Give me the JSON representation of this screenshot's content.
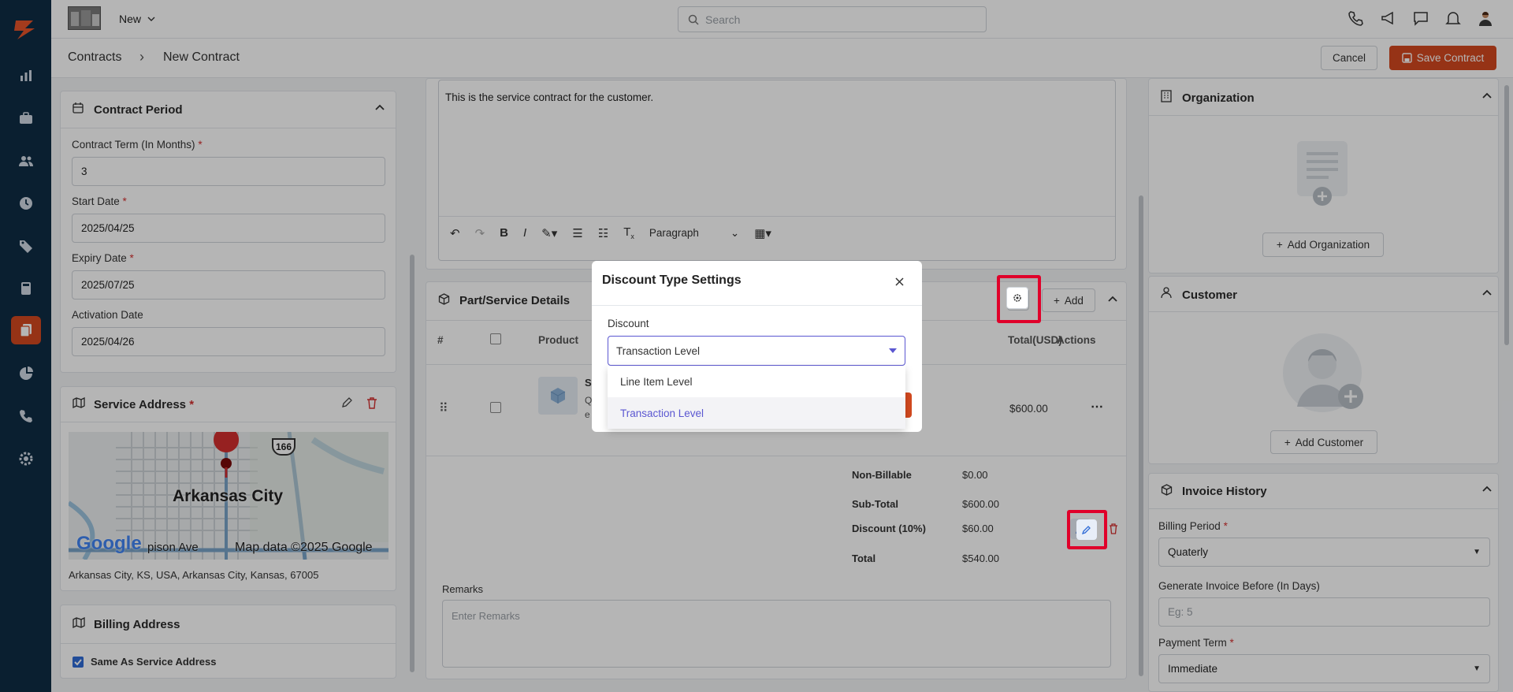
{
  "topbar": {
    "new_label": "New",
    "search_placeholder": "Search"
  },
  "breadcrumb": {
    "root": "Contracts",
    "separator": "›",
    "current": "New Contract"
  },
  "actions": {
    "cancel": "Cancel",
    "save": "Save Contract"
  },
  "contract_period": {
    "title": "Contract Period",
    "term_label": "Contract Term (In Months)",
    "term_value": "3",
    "start_label": "Start Date",
    "start_value": "2025/04/25",
    "expiry_label": "Expiry Date",
    "expiry_value": "2025/07/25",
    "activation_label": "Activation Date",
    "activation_value": "2025/04/26"
  },
  "service_address": {
    "title": "Service Address",
    "map_city": "Arkansas City",
    "map_shield": "166",
    "map_street": "pison Ave",
    "map_google": "Google",
    "map_credit": "Map data ©2025 Google",
    "address": "Arkansas City, KS, USA, Arkansas City, Kansas, 67005"
  },
  "billing_address": {
    "title": "Billing Address",
    "same_as": "Same As Service Address"
  },
  "description": {
    "text": "This is the service contract for the customer.",
    "format_label": "Paragraph"
  },
  "parts": {
    "title": "Part/Service Details",
    "add_label": "Add",
    "col_hash": "#",
    "col_product": "Product",
    "col_total": "Total(USD)",
    "col_actions": "Actions",
    "row_total": "$600.00",
    "row_frag_s": "S",
    "row_frag_q": "Q",
    "row_frag_e": "e",
    "non_billable_label": "Non-Billable",
    "non_billable_value": "$0.00",
    "subtotal_label": "Sub-Total",
    "subtotal_value": "$600.00",
    "discount_label": "Discount (10%)",
    "discount_value": "$60.00",
    "total_label": "Total",
    "total_value": "$540.00",
    "remarks_label": "Remarks",
    "remarks_placeholder": "Enter Remarks"
  },
  "organization": {
    "title": "Organization",
    "add_label": "Add Organization"
  },
  "customer": {
    "title": "Customer",
    "add_label": "Add Customer"
  },
  "invoice_history": {
    "title": "Invoice History",
    "billing_period_label": "Billing Period",
    "billing_period_value": "Quaterly",
    "generate_label": "Generate Invoice Before (In Days)",
    "generate_placeholder": "Eg: 5",
    "payment_term_label": "Payment Term",
    "payment_term_value": "Immediate"
  },
  "modal": {
    "title": "Discount Type Settings",
    "field_label": "Discount",
    "selected": "Transaction Level",
    "options": [
      "Line Item Level",
      "Transaction Level"
    ]
  },
  "colors": {
    "brand": "#d3491f",
    "sidebar": "#0f2d44",
    "accent": "#5b57d1",
    "highlight": "#e0002a"
  }
}
